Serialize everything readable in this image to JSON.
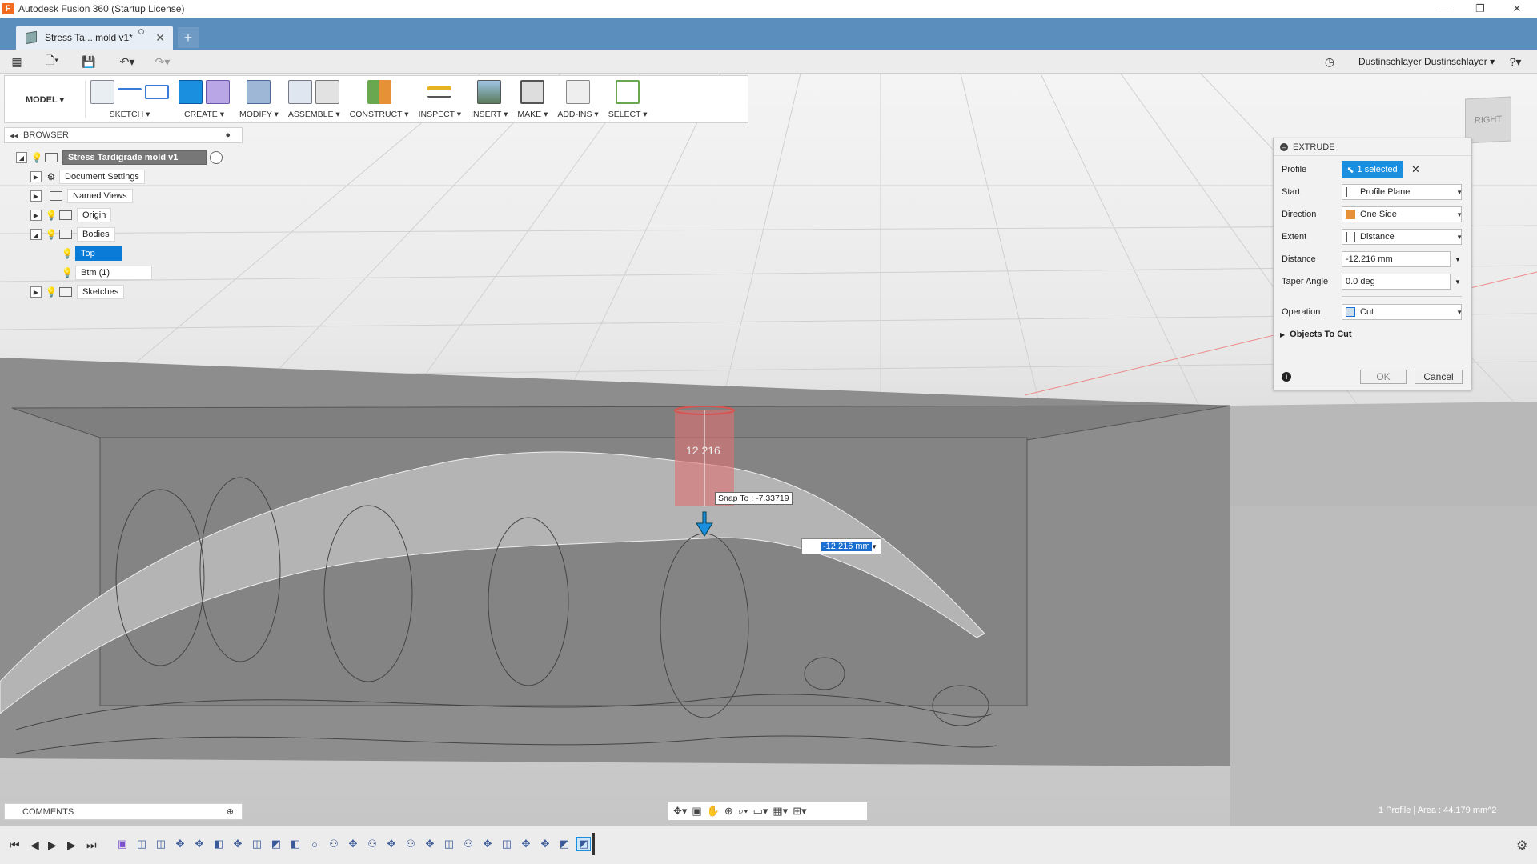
{
  "window": {
    "title": "Autodesk Fusion 360 (Startup License)"
  },
  "tab": {
    "label": "Stress Ta... mold v1*"
  },
  "user": {
    "name": "Dustinschlayer Dustinschlayer"
  },
  "workspace": {
    "label": "MODEL ▾"
  },
  "toolbar": {
    "groups": [
      "SKETCH ▾",
      "CREATE ▾",
      "MODIFY ▾",
      "ASSEMBLE ▾",
      "CONSTRUCT ▾",
      "INSPECT ▾",
      "INSERT ▾",
      "MAKE ▾",
      "ADD-INS ▾",
      "SELECT ▾"
    ]
  },
  "browser": {
    "title": "BROWSER",
    "root": "Stress Tardigrade mold v1",
    "items": [
      "Document Settings",
      "Named Views",
      "Origin",
      "Bodies",
      "Top",
      "Btm (1)",
      "Sketches"
    ]
  },
  "viewcube": {
    "label": "RIGHT"
  },
  "extrude": {
    "title": "EXTRUDE",
    "profile_label": "Profile",
    "profile_value": "1 selected",
    "start_label": "Start",
    "start_value": "Profile Plane",
    "direction_label": "Direction",
    "direction_value": "One Side",
    "extent_label": "Extent",
    "extent_value": "Distance",
    "distance_label": "Distance",
    "distance_value": "-12.216 mm",
    "taper_label": "Taper Angle",
    "taper_value": "0.0 deg",
    "operation_label": "Operation",
    "operation_value": "Cut",
    "objects_label": "Objects To Cut",
    "ok": "OK",
    "cancel": "Cancel"
  },
  "canvas": {
    "dim_label": "12.216",
    "snap": "Snap To : -7.33719",
    "input_value": "-12.216 mm"
  },
  "comments": {
    "label": "COMMENTS"
  },
  "status": {
    "right": "1 Profile | Area : 44.179 mm^2"
  },
  "colors": {
    "accent": "#1a8fe0",
    "tabstrip": "#5b8dbd",
    "cut": "#d9534f"
  }
}
